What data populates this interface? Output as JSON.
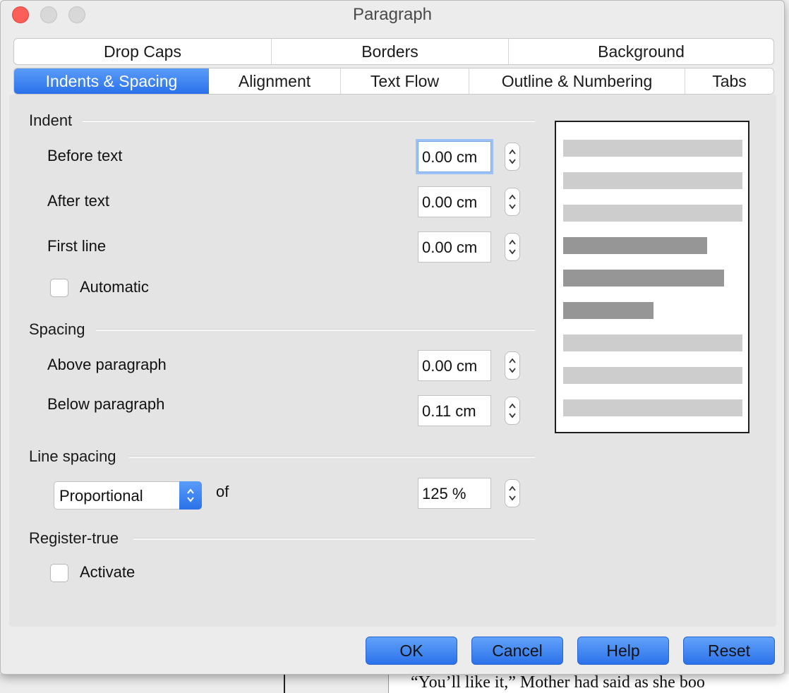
{
  "window": {
    "title": "Paragraph"
  },
  "tabs": {
    "row1": [
      "Drop Caps",
      "Borders",
      "Background"
    ],
    "row2": [
      "Indents & Spacing",
      "Alignment",
      "Text Flow",
      "Outline & Numbering",
      "Tabs"
    ],
    "active": "Indents & Spacing"
  },
  "indent": {
    "heading": "Indent",
    "before_text": {
      "label": "Before text",
      "value": "0.00 cm"
    },
    "after_text": {
      "label": "After text",
      "value": "0.00 cm"
    },
    "first_line": {
      "label": "First line",
      "value": "0.00 cm"
    },
    "automatic": {
      "label": "Automatic",
      "checked": false
    }
  },
  "spacing": {
    "heading": "Spacing",
    "above_paragraph": {
      "label": "Above paragraph",
      "value": "0.00 cm"
    },
    "below_paragraph": {
      "label": "Below paragraph",
      "value": "0.11 cm"
    }
  },
  "line_spacing": {
    "heading": "Line spacing",
    "mode": "Proportional",
    "of_label": "of",
    "value": "125 %"
  },
  "register_true": {
    "heading": "Register-true",
    "activate": {
      "label": "Activate",
      "checked": false
    }
  },
  "buttons": {
    "ok": "OK",
    "cancel": "Cancel",
    "help": "Help",
    "reset": "Reset"
  },
  "background_document": {
    "text": "“You’ll like it,” Mother had said as she boo"
  },
  "colors": {
    "accent": "#2a71ea",
    "close_button": "#fc5f57",
    "preview_light": "#cdcdcd",
    "preview_dark": "#969696"
  }
}
